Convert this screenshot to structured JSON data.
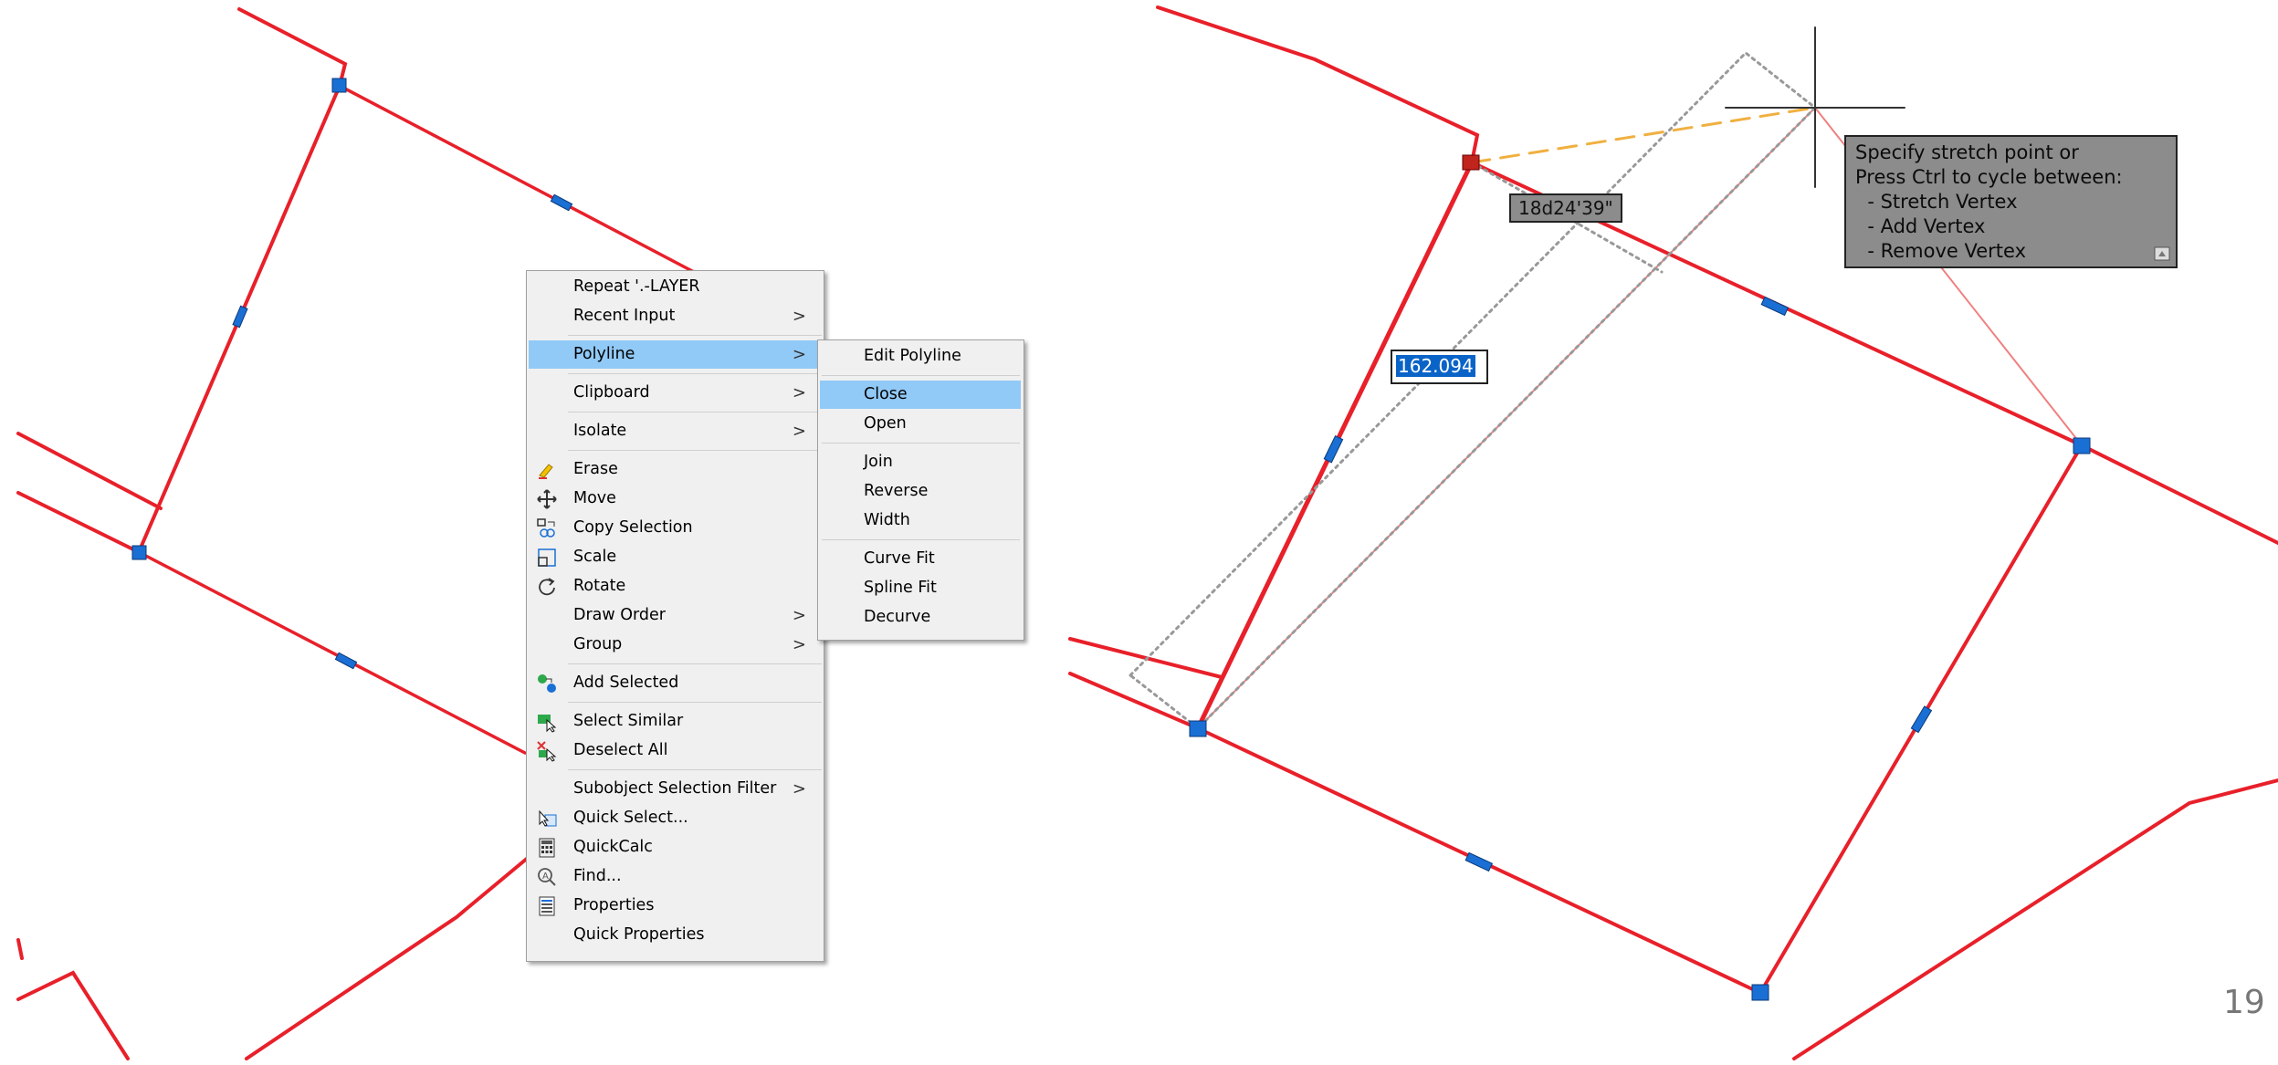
{
  "context_menu": {
    "items": [
      {
        "label": "Repeat '.-LAYER",
        "submenu": false
      },
      {
        "label": "Recent Input",
        "submenu": true
      },
      {
        "label": "Polyline",
        "submenu": true,
        "highlighted": true
      },
      {
        "label": "Clipboard",
        "submenu": true
      },
      {
        "label": "Isolate",
        "submenu": true
      },
      {
        "label": "Erase",
        "icon": "erase-icon"
      },
      {
        "label": "Move",
        "icon": "move-icon"
      },
      {
        "label": "Copy Selection",
        "icon": "copy-selection-icon"
      },
      {
        "label": "Scale",
        "icon": "scale-icon"
      },
      {
        "label": "Rotate",
        "icon": "rotate-icon"
      },
      {
        "label": "Draw Order",
        "submenu": true
      },
      {
        "label": "Group",
        "submenu": true
      },
      {
        "label": "Add Selected",
        "icon": "add-selected-icon"
      },
      {
        "label": "Select Similar",
        "icon": "select-similar-icon"
      },
      {
        "label": "Deselect All",
        "icon": "deselect-all-icon"
      },
      {
        "label": "Subobject Selection Filter",
        "submenu": true
      },
      {
        "label": "Quick Select...",
        "icon": "quick-select-icon"
      },
      {
        "label": "QuickCalc",
        "icon": "calculator-icon"
      },
      {
        "label": "Find...",
        "icon": "find-icon"
      },
      {
        "label": "Properties",
        "icon": "properties-icon"
      },
      {
        "label": "Quick Properties"
      }
    ],
    "arrow": ">"
  },
  "submenu": {
    "items": [
      {
        "label": "Edit Polyline"
      },
      {
        "label": "Close",
        "highlighted": true
      },
      {
        "label": "Open"
      },
      {
        "label": "Join"
      },
      {
        "label": "Reverse"
      },
      {
        "label": "Width"
      },
      {
        "label": "Curve Fit"
      },
      {
        "label": "Spline Fit"
      },
      {
        "label": "Decurve"
      }
    ]
  },
  "tooltip": {
    "text": "Specify stretch point or\nPress Ctrl to cycle between:\n  - Stretch Vertex\n  - Add Vertex\n  - Remove Vertex"
  },
  "angle_readout": "18d24'39\"",
  "length_input": "162.094",
  "page_number": "19",
  "colors": {
    "polyline": "#e8202a",
    "grip": "#1a6fd4",
    "highlight": "#91c9f7",
    "tooltip_bg": "#8c8c8c"
  }
}
